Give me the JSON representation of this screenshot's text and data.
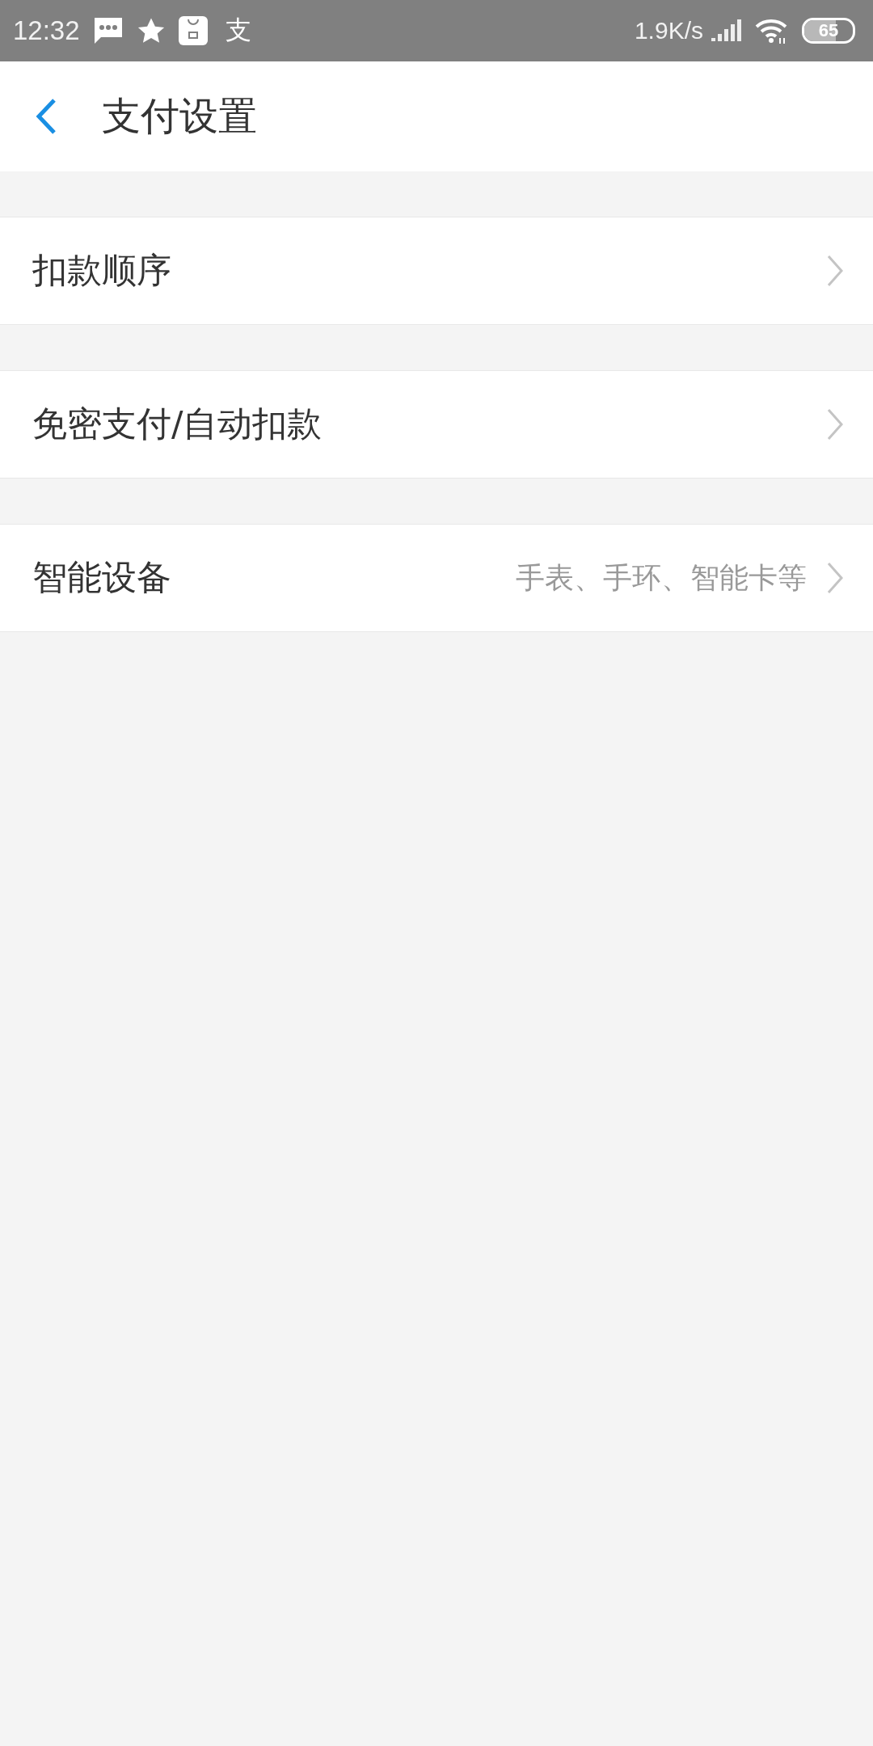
{
  "status_bar": {
    "time": "12:32",
    "app_glyph": "支",
    "speed": "1.9K/s",
    "battery": "65"
  },
  "header": {
    "title": "支付设置"
  },
  "items": [
    {
      "label": "扣款顺序"
    },
    {
      "label": "免密支付/自动扣款"
    },
    {
      "label": "智能设备",
      "hint": "手表、手环、智能卡等"
    }
  ]
}
